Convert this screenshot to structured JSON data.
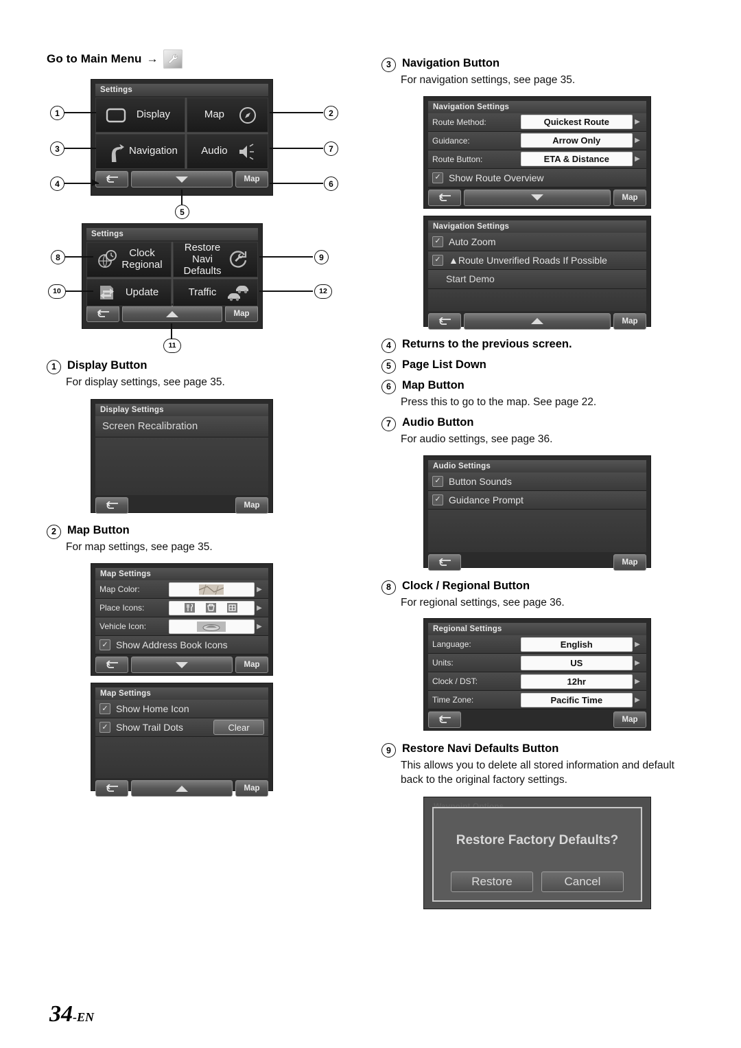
{
  "page": {
    "number": "34",
    "suffix": "-EN"
  },
  "header": {
    "title": "Go to Main Menu",
    "arrow": "→",
    "icon": "wrench-icon"
  },
  "settings_menu_1": {
    "title": "Settings",
    "tiles": [
      {
        "label": "Display",
        "icon": "display-rectangle-icon"
      },
      {
        "label": "Map",
        "icon": "compass-icon"
      },
      {
        "label": "Navigation",
        "icon": "turn-arrow-icon"
      },
      {
        "label": "Audio",
        "icon": "speaker-icon"
      }
    ],
    "toolbar": {
      "back": "back-arrow-icon",
      "page": "page-down-arrow-icon",
      "map": "Map"
    },
    "callouts": [
      "1",
      "2",
      "3",
      "7",
      "4",
      "6",
      "5"
    ]
  },
  "settings_menu_2": {
    "title": "Settings",
    "tiles": [
      {
        "label": "Clock\nRegional",
        "line1": "Clock",
        "line2": "Regional",
        "icon": "clock-globe-icon"
      },
      {
        "label": "Restore Navi Defaults",
        "line1": "Restore",
        "line2": "Navi Defaults",
        "icon": "restore-wrench-icon"
      },
      {
        "label": "Update",
        "line1": "Update",
        "line2": "",
        "icon": "update-icon"
      },
      {
        "label": "Traffic",
        "line1": "Traffic",
        "line2": "",
        "icon": "traffic-cars-icon"
      }
    ],
    "toolbar": {
      "back": "back-arrow-icon",
      "page": "page-up-arrow-icon",
      "map": "Map"
    },
    "callouts": [
      "8",
      "9",
      "10",
      "12",
      "11"
    ]
  },
  "items": [
    {
      "num": "1",
      "title": "Display Button",
      "desc": "For display settings, see page 35."
    },
    {
      "num": "2",
      "title": "Map Button",
      "desc": "For map settings, see page 35."
    },
    {
      "num": "3",
      "title": "Navigation Button",
      "desc": "For navigation settings, see page 35."
    },
    {
      "num": "4",
      "title": "Returns to the previous screen.",
      "desc": ""
    },
    {
      "num": "5",
      "title": "Page List Down",
      "desc": ""
    },
    {
      "num": "6",
      "title": "Map Button",
      "desc": "Press this to go to the map. See page 22."
    },
    {
      "num": "7",
      "title": "Audio Button",
      "desc": "For audio settings, see page 36."
    },
    {
      "num": "8",
      "title": "Clock / Regional Button",
      "desc": "For regional settings, see page 36."
    },
    {
      "num": "9",
      "title": "Restore Navi Defaults Button",
      "desc": "This allows you to delete all stored information and default back to the original factory settings."
    }
  ],
  "display_settings": {
    "title": "Display Settings",
    "rows": [
      {
        "label": "Screen Recalibration"
      }
    ],
    "toolbar": {
      "back": "back-arrow-icon",
      "map": "Map"
    }
  },
  "map_settings_1": {
    "title": "Map Settings",
    "rows": [
      {
        "label": "Map Color:",
        "value": "",
        "icon": "map-thumbnail-icon",
        "caret": "▶"
      },
      {
        "label": "Place Icons:",
        "value": "",
        "icons": [
          "restaurant-icon",
          "shopping-icon",
          "lodging-icon"
        ],
        "caret": "▶"
      },
      {
        "label": "Vehicle Icon:",
        "value": "",
        "icon": "vehicle-icon",
        "caret": "▶"
      }
    ],
    "check_rows": [
      {
        "label": "Show Address Book Icons",
        "checked": true
      }
    ],
    "toolbar": {
      "back": "back-arrow-icon",
      "page": "page-down-arrow-icon",
      "map": "Map"
    }
  },
  "map_settings_2": {
    "title": "Map Settings",
    "check_rows": [
      {
        "label": "Show Home Icon",
        "checked": true,
        "button": ""
      },
      {
        "label": "Show Trail Dots",
        "checked": true,
        "button": "Clear"
      }
    ],
    "toolbar": {
      "back": "back-arrow-icon",
      "page": "page-up-arrow-icon",
      "map": "Map"
    }
  },
  "navigation_settings_1": {
    "title": "Navigation Settings",
    "rows": [
      {
        "label": "Route Method:",
        "value": "Quickest Route",
        "caret": "▶"
      },
      {
        "label": "Guidance:",
        "value": "Arrow Only",
        "caret": "▶"
      },
      {
        "label": "Route Button:",
        "value": "ETA & Distance",
        "caret": "▶"
      }
    ],
    "check_rows": [
      {
        "label": "Show Route Overview",
        "checked": true
      }
    ],
    "toolbar": {
      "back": "back-arrow-icon",
      "page": "page-down-arrow-icon",
      "map": "Map"
    }
  },
  "navigation_settings_2": {
    "title": "Navigation Settings",
    "check_rows": [
      {
        "label": "Auto Zoom",
        "checked": true
      },
      {
        "label": "▲Route Unverified Roads If Possible",
        "checked": true
      }
    ],
    "plain_rows": [
      {
        "label": "Start Demo"
      }
    ],
    "toolbar": {
      "back": "back-arrow-icon",
      "page": "page-up-arrow-icon",
      "map": "Map"
    }
  },
  "audio_settings": {
    "title": "Audio Settings",
    "check_rows": [
      {
        "label": "Button Sounds",
        "checked": true
      },
      {
        "label": "Guidance Prompt",
        "checked": true
      }
    ],
    "toolbar": {
      "back": "back-arrow-icon",
      "map": "Map"
    }
  },
  "regional_settings": {
    "title": "Regional Settings",
    "rows": [
      {
        "label": "Language:",
        "value": "English",
        "caret": "▶"
      },
      {
        "label": "Units:",
        "value": "US",
        "caret": "▶"
      },
      {
        "label": "Clock / DST:",
        "value": "12hr",
        "caret": "▶"
      },
      {
        "label": "Time Zone:",
        "value": "Pacific Time",
        "caret": "▶"
      }
    ],
    "toolbar": {
      "back": "back-arrow-icon",
      "map": "Map"
    }
  },
  "restore_dialog": {
    "ghost_title": "Waypoint Options",
    "message": "Restore Factory Defaults?",
    "buttons": [
      "Restore",
      "Cancel"
    ]
  },
  "colors": {
    "screen_bg": "#2b2b2b",
    "row_bg": "#4c4c4c",
    "value_bg": "#fafafa",
    "text": "#e9e9e9"
  }
}
